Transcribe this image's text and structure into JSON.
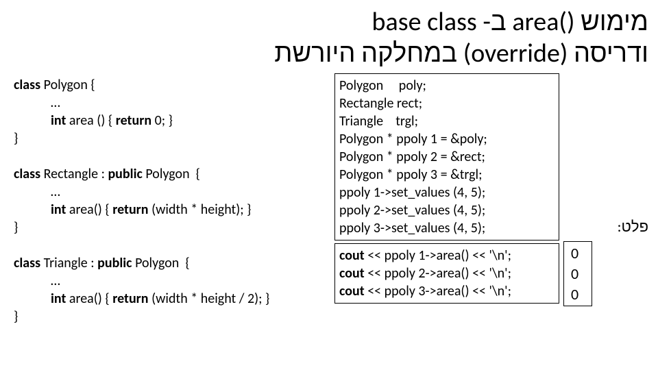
{
  "title": {
    "line1_rtl_pre": "מימוש",
    "line1_ltr": " area() ",
    "line1_rtl_post": "ב- base class",
    "line2_rtl_pre": "ודריסה",
    "line2_ltr": " (override) ",
    "line2_rtl_post": "במחלקה היורשת"
  },
  "left_box": {
    "l1a": "class",
    "l1b": " Polygon {",
    "l2": "…",
    "l3a": "int ",
    "l3b": "area ",
    "l3c": "() { ",
    "l3d": "return ",
    "l3e": "0; }",
    "l4": "}",
    "blank": "",
    "l5a": "class ",
    "l5b": "Rectangle : ",
    "l5c": "public ",
    "l5d": "Polygon  {",
    "l6": "…",
    "l7a": "int ",
    "l7b": "area() { ",
    "l7c": "return ",
    "l7d": "(width * height); }",
    "l8": "}",
    "l9a": "class ",
    "l9b": "Triangle : ",
    "l9c": "public ",
    "l9d": "Polygon  {",
    "l10": "…",
    "l11a": "int ",
    "l11b": "area() { ",
    "l11c": "return ",
    "l11d": "(width * height / 2); }",
    "l12": "}"
  },
  "mid_box1": {
    "l1": "Polygon     poly;",
    "l2": "Rectangle rect;",
    "l3": "Triangle    trgl;",
    "l4": "Polygon * ppoly 1 = &poly;",
    "l5": "Polygon * ppoly 2 = &rect;",
    "l6": "Polygon * ppoly 3 = &trgl;",
    "l7": "ppoly 1->set_values (4, 5);",
    "l8": "ppoly 2->set_values (4, 5);",
    "l9": "ppoly 3->set_values (4, 5);"
  },
  "mid_box2": {
    "l1a": "cout",
    "l1b": " << ppoly 1->area() << '\\n';",
    "l2a": "cout",
    "l2b": " << ppoly 2->area() << '\\n';",
    "l3a": "cout",
    "l3b": " << ppoly 3->area() << '\\n';"
  },
  "output": {
    "label": "פלט:",
    "l1": "0",
    "l2": "0",
    "l3": "0"
  }
}
